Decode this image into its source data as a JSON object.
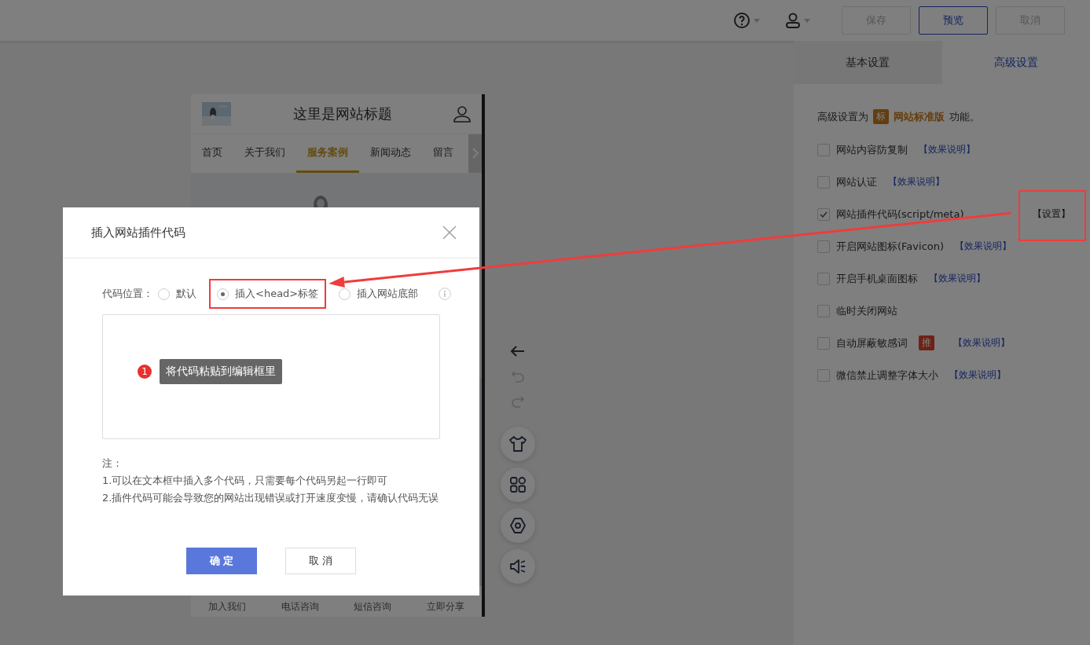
{
  "toolbar": {
    "buttons": [
      {
        "label": "保存",
        "disabled": true,
        "primary": false
      },
      {
        "label": "预览",
        "disabled": false,
        "primary": true
      },
      {
        "label": "取消",
        "disabled": true,
        "primary": false
      }
    ]
  },
  "preview": {
    "site_title": "这里是网站标题",
    "nav": [
      {
        "label": "首页",
        "selected": false
      },
      {
        "label": "关于我们",
        "selected": false
      },
      {
        "label": "服务案例",
        "selected": true
      },
      {
        "label": "新闻动态",
        "selected": false
      },
      {
        "label": "留言",
        "selected": false
      }
    ],
    "bottom_nav": [
      "加入我们",
      "电话咨询",
      "短信咨询",
      "立即分享"
    ]
  },
  "settings_panel": {
    "tabs": [
      {
        "label": "基本设置",
        "selected": false
      },
      {
        "label": "高级设置",
        "selected": true
      }
    ],
    "intro": {
      "prefix": "高级设置为",
      "badge": "标",
      "edition": "网站标准版",
      "suffix": "功能。"
    },
    "options": [
      {
        "label": "网站内容防复制",
        "checked": false,
        "action": {
          "kind": "help",
          "label": "【效果说明】"
        }
      },
      {
        "label": "网站认证",
        "checked": false,
        "action": {
          "kind": "help",
          "label": "【效果说明】"
        }
      },
      {
        "label": "网站插件代码(script/meta)",
        "checked": true,
        "action": {
          "kind": "settings",
          "label": "【设置】"
        }
      },
      {
        "label": "开启网站图标(Favicon)",
        "checked": false,
        "action": {
          "kind": "help",
          "label": "【效果说明】"
        }
      },
      {
        "label": "开启手机桌面图标",
        "checked": false,
        "action": {
          "kind": "help",
          "label": "【效果说明】"
        }
      },
      {
        "label": "临时关闭网站",
        "checked": false
      },
      {
        "label": "自动屏蔽敏感词",
        "checked": false,
        "badge": "推",
        "action": {
          "kind": "help",
          "label": "【效果说明】"
        }
      },
      {
        "label": "微信禁止调整字体大小",
        "checked": false,
        "action": {
          "kind": "help",
          "label": "【效果说明】"
        }
      }
    ]
  },
  "dialog": {
    "title": "插入网站插件代码",
    "position_label": "代码位置：",
    "positions": [
      {
        "label": "默认",
        "selected": false
      },
      {
        "label": "插入<head>标签",
        "selected": true
      },
      {
        "label": "插入网站底部",
        "selected": false
      }
    ],
    "tooltip": {
      "step": "1",
      "text": "将代码粘贴到编辑框里"
    },
    "notes": [
      "注：",
      "1.可以在文本框中插入多个代码，只需要每个代码另起一行即可",
      "2.插件代码可能会导致您的网站出现错误或打开速度变慢，请确认代码无误"
    ],
    "buttons": [
      {
        "label": "确 定",
        "primary": true
      },
      {
        "label": "取 消",
        "primary": false
      }
    ]
  }
}
